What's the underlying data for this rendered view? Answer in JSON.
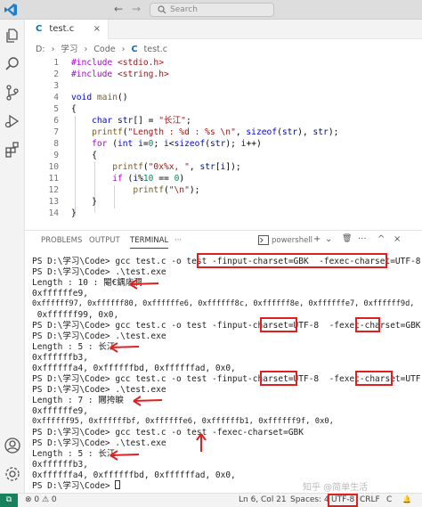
{
  "titlebar": {
    "search_placeholder": "Search",
    "nav_back": "←",
    "nav_forward": "→"
  },
  "tab": {
    "icon_text": "C",
    "label": "test.c",
    "close": "×"
  },
  "breadcrumb": {
    "items": [
      "D:",
      "学习",
      "Code",
      "test.c"
    ],
    "separator": "›"
  },
  "editor": {
    "line_numbers": [
      "1",
      "2",
      "3",
      "4",
      "5",
      "6",
      "7",
      "8",
      "9",
      "10",
      "11",
      "12",
      "13",
      "14"
    ]
  },
  "panel": {
    "tabs": [
      "PROBLEMS",
      "OUTPUT",
      "TERMINAL",
      "···"
    ],
    "active_tab": "TERMINAL",
    "shell": "powershell",
    "tools": [
      "+",
      "⌄",
      "🗑",
      "···",
      "^",
      "×"
    ]
  },
  "terminal": {
    "lines": [
      "PS D:\\学习\\Code> gcc test.c -o test -finput-charset=GBK  -fexec-charset=UTF-8",
      "PS D:\\学习\\Code> .\\test.exe",
      "Length : 10 : 閹€鍝庡澗",
      "0xffffffe9,",
      "0xffffff97, 0xffffff80, 0xffffffe6, 0xffffff8c, 0xffffff8e, 0xffffffe7, 0xffffff9d,",
      " 0xffffff99, 0x0,",
      "PS D:\\学习\\Code> gcc test.c -o test -finput-charset=UTF-8  -fexec-charset=GBK",
      "PS D:\\学习\\Code> .\\test.exe",
      "Length : 5 : 长江",
      "0xffffffb3,",
      "0xffffffa4, 0xffffffbd, 0xffffffad, 0x0,",
      "PS D:\\学习\\Code> gcc test.c -o test -finput-charset=UTF-8  -fexec-charset=UTF-8",
      "PS D:\\学习\\Code> .\\test.exe",
      "Length : 7 : 闀挎睙",
      "0xffffffe9,",
      "0xffffff95, 0xffffffbf, 0xffffffe6, 0xffffffb1, 0xffffff9f, 0x0,",
      "PS D:\\学习\\Code> gcc test.c -o test -fexec-charset=GBK",
      "PS D:\\学习\\Code> .\\test.exe",
      "Length : 5 : 长江",
      "0xffffffb3,",
      "0xffffffa4, 0xffffffbd, 0xffffffad, 0x0,",
      "PS D:\\学习\\Code> "
    ]
  },
  "statusbar": {
    "remote": "⧉",
    "problems": "⊗ 0 ⚠ 0",
    "position": "Ln 6, Col 21",
    "spaces": "Spaces: 4",
    "encoding": "UTF-8",
    "eol": "CRLF",
    "language": "C",
    "bell": "🔔"
  },
  "watermark": "知乎 @简单生活",
  "colors": {
    "highlight_box": "#e02020",
    "keyword": "#0000ff",
    "string": "#a31515",
    "preprocessor": "#af00db",
    "status_remote": "#16825d"
  }
}
